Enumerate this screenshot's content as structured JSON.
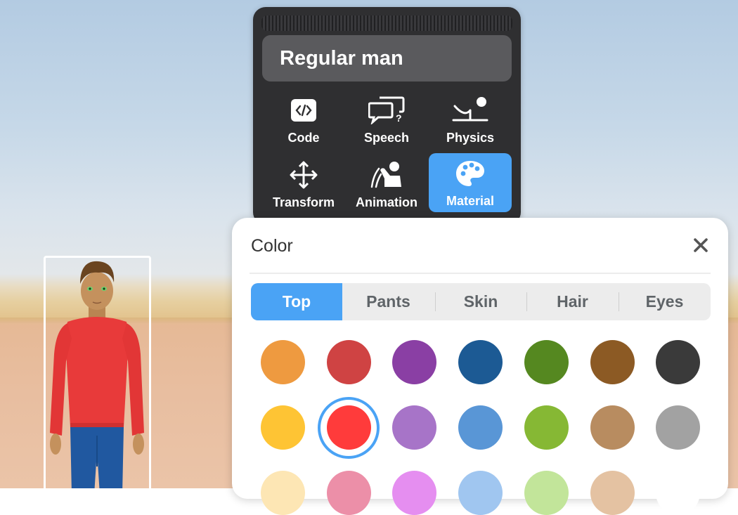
{
  "object_panel": {
    "name": "Regular man",
    "tools": [
      {
        "label": "Code",
        "icon": "code-icon"
      },
      {
        "label": "Speech",
        "icon": "speech-bubbles-icon"
      },
      {
        "label": "Physics",
        "icon": "physics-icon"
      },
      {
        "label": "Transform",
        "icon": "move-arrows-icon"
      },
      {
        "label": "Animation",
        "icon": "animation-figure-icon"
      },
      {
        "label": "Material",
        "icon": "palette-icon",
        "active": true
      }
    ]
  },
  "color_panel": {
    "title": "Color",
    "tabs": [
      {
        "label": "Top",
        "active": true
      },
      {
        "label": "Pants"
      },
      {
        "label": "Skin"
      },
      {
        "label": "Hair"
      },
      {
        "label": "Eyes"
      }
    ],
    "swatches": [
      [
        "#ee9a40",
        "#cf4343",
        "#8a3fa4",
        "#1c5a94",
        "#558820",
        "#8c5a24",
        "#3a3a3a"
      ],
      [
        "#fec434",
        "#ff3b3b",
        "#a774c8",
        "#5996d6",
        "#86b834",
        "#b88c60",
        "#a2a2a2"
      ],
      [
        "#fde6b4",
        "#ec8fa8",
        "#e58ef0",
        "#a0c6f0",
        "#c2e59a",
        "#e4c2a2",
        "#ffffff"
      ]
    ],
    "selected_swatch": "#ff3b3b"
  },
  "colors": {
    "accent": "#4aa3f5",
    "panel_dark": "#2f2f31",
    "shirt": "#e83a3a",
    "pants": "#2058a0"
  }
}
